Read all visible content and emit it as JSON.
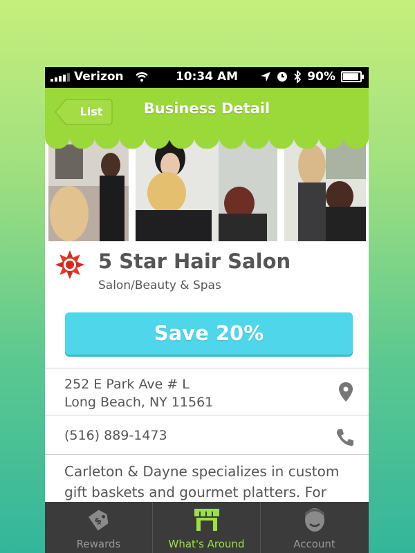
{
  "status_bar": {
    "carrier": "Verizon",
    "time": "10:34 AM",
    "battery": "90%"
  },
  "nav": {
    "back_label": "List",
    "title": "Business Detail"
  },
  "business": {
    "name": "5 Star Hair Salon",
    "category": "Salon/Beauty & Spas",
    "offer_label": "Save 20%",
    "address_line1": "252 E Park Ave # L",
    "address_line2": "Long Beach, NY 11561",
    "phone": "(516) 889-1473",
    "description": "Carleton & Dayne specializes in custom gift baskets and gourmet platters. For"
  },
  "tabs": [
    {
      "label": "Rewards",
      "icon": "price-tag-icon",
      "active": false
    },
    {
      "label": "What's Around",
      "icon": "storefront-icon",
      "active": true
    },
    {
      "label": "Account",
      "icon": "person-icon",
      "active": false
    }
  ],
  "colors": {
    "accent_green": "#9bd83a",
    "button_blue": "#4fd6ea",
    "tab_active": "#9be23f"
  }
}
